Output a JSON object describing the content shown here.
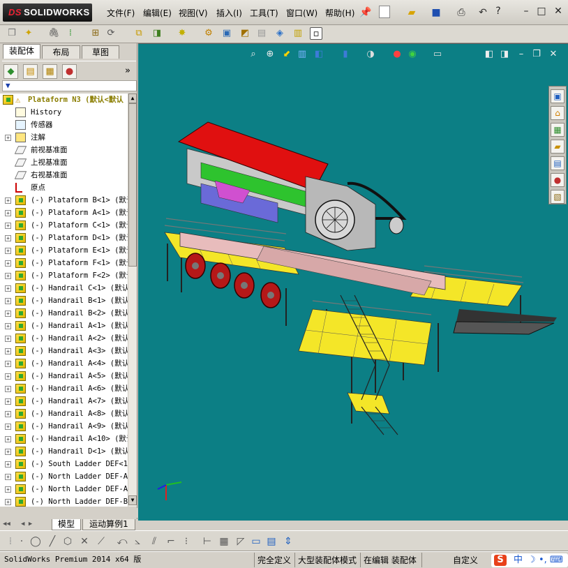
{
  "app": {
    "logo_prefix": "DS",
    "logo_text": "SOLIDWORKS"
  },
  "menu": {
    "items": [
      "文件(F)",
      "编辑(E)",
      "视图(V)",
      "插入(I)",
      "工具(T)",
      "窗口(W)",
      "帮助(H)"
    ]
  },
  "window_controls": {
    "help": "?",
    "minimize": "–",
    "restore": "□",
    "close": "✕"
  },
  "left_panel": {
    "tabs": [
      "装配体",
      "布局",
      "草图"
    ],
    "active_tab": "装配体",
    "filter_icon": "funnel-icon",
    "collapse": "»",
    "tree": [
      {
        "label": "Plataform N3  (默认<默认",
        "icon": "assembly-warning",
        "expand": "",
        "level": 0,
        "color": "#8a7d00"
      },
      {
        "label": "History",
        "icon": "history",
        "expand": "",
        "level": 1
      },
      {
        "label": "传感器",
        "icon": "sensor",
        "expand": "",
        "level": 1
      },
      {
        "label": "注解",
        "icon": "annotation",
        "expand": "+",
        "level": 1
      },
      {
        "label": "前视基准面",
        "icon": "plane",
        "expand": "",
        "level": 1
      },
      {
        "label": "上视基准面",
        "icon": "plane",
        "expand": "",
        "level": 1
      },
      {
        "label": "右视基准面",
        "icon": "plane",
        "expand": "",
        "level": 1
      },
      {
        "label": "原点",
        "icon": "origin",
        "expand": "",
        "level": 1
      },
      {
        "label": "(-) Plataform B<1> (默认",
        "icon": "assembly",
        "expand": "+",
        "level": 1
      },
      {
        "label": "(-) Plataform A<1> (默认",
        "icon": "assembly",
        "expand": "+",
        "level": 1
      },
      {
        "label": "(-) Plataform C<1> (默认",
        "icon": "assembly",
        "expand": "+",
        "level": 1
      },
      {
        "label": "(-) Plataform D<1> (默认",
        "icon": "assembly",
        "expand": "+",
        "level": 1
      },
      {
        "label": "(-) Plataform E<1> (默认",
        "icon": "assembly",
        "expand": "+",
        "level": 1
      },
      {
        "label": "(-) Plataform F<1> (默认",
        "icon": "assembly",
        "expand": "+",
        "level": 1
      },
      {
        "label": "(-) Plataform F<2> (默认",
        "icon": "assembly",
        "expand": "+",
        "level": 1
      },
      {
        "label": "(-) Handrail C<1> (默认",
        "icon": "assembly",
        "expand": "+",
        "level": 1
      },
      {
        "label": "(-) Handrail B<1> (默认",
        "icon": "assembly",
        "expand": "+",
        "level": 1
      },
      {
        "label": "(-) Handrail B<2> (默认",
        "icon": "assembly",
        "expand": "+",
        "level": 1
      },
      {
        "label": "(-) Handrail A<1> (默认",
        "icon": "assembly",
        "expand": "+",
        "level": 1
      },
      {
        "label": "(-) Handrail A<2> (默认",
        "icon": "assembly",
        "expand": "+",
        "level": 1
      },
      {
        "label": "(-) Handrail A<3> (默认",
        "icon": "assembly",
        "expand": "+",
        "level": 1
      },
      {
        "label": "(-) Handrail A<4> (默认",
        "icon": "assembly",
        "expand": "+",
        "level": 1
      },
      {
        "label": "(-) Handrail A<5> (默认",
        "icon": "assembly",
        "expand": "+",
        "level": 1
      },
      {
        "label": "(-) Handrail A<6> (默认",
        "icon": "assembly",
        "expand": "+",
        "level": 1
      },
      {
        "label": "(-) Handrail A<7> (默认",
        "icon": "assembly",
        "expand": "+",
        "level": 1
      },
      {
        "label": "(-) Handrail A<8> (默认",
        "icon": "assembly",
        "expand": "+",
        "level": 1
      },
      {
        "label": "(-) Handrail A<9> (默认",
        "icon": "assembly",
        "expand": "+",
        "level": 1
      },
      {
        "label": "(-) Handrail A<10> (默认",
        "icon": "assembly",
        "expand": "+",
        "level": 1
      },
      {
        "label": "(-) Handrail D<1> (默认",
        "icon": "assembly",
        "expand": "+",
        "level": 1
      },
      {
        "label": "(-) South Ladder DEF<1>",
        "icon": "assembly",
        "expand": "+",
        "level": 1
      },
      {
        "label": "(-) North Ladder DEF-A<",
        "icon": "assembly",
        "expand": "+",
        "level": 1
      },
      {
        "label": "(-) North Ladder DEF-A<",
        "icon": "assembly",
        "expand": "+",
        "level": 1
      },
      {
        "label": "(-) North Ladder DEF-B<",
        "icon": "assembly",
        "expand": "+",
        "level": 1
      }
    ],
    "bottom_tabs": [
      "模型",
      "运动算例1"
    ]
  },
  "viewport": {
    "background": "#0c7f85"
  },
  "status": {
    "app_info": "SolidWorks Premium 2014 x64 版",
    "fully_defined": "完全定义",
    "large_assembly": "大型装配体模式",
    "editing": "在编辑 装配体",
    "custom": "自定义",
    "ime_lang": "中"
  },
  "colors": {
    "ui_gray": "#d4d0c8",
    "viewport": "#0c7f85",
    "hopper_red": "#e01010",
    "platform_yellow": "#f4e628",
    "frame_pink": "#e8bcbc",
    "green_guard": "#2ec32e"
  }
}
